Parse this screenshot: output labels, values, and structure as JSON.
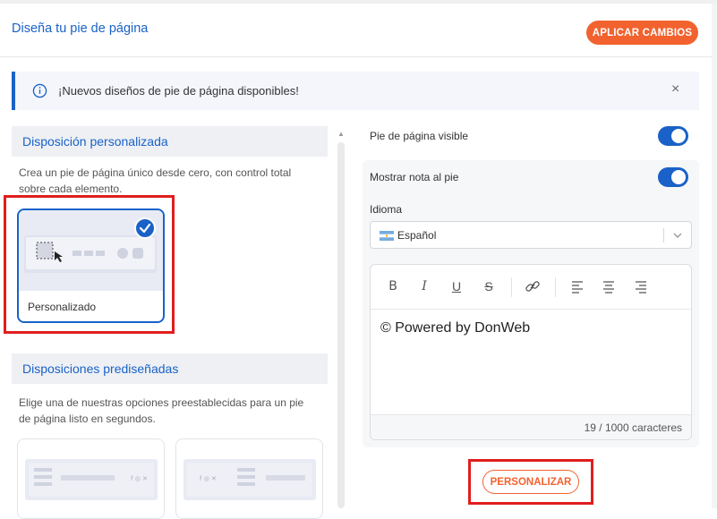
{
  "header": {
    "title": "Diseña tu pie de página",
    "apply_label": "APLICAR CAMBIOS"
  },
  "alert": {
    "message": "¡Nuevos diseños de pie de página disponibles!",
    "info_icon": "info-icon",
    "close_icon": "close-icon",
    "close_glyph": "×"
  },
  "custom_section": {
    "heading": "Disposición personalizada",
    "description": "Crea un pie de página único desde cero, con control total sobre cada elemento.",
    "card_label": "Personalizado"
  },
  "preset_section": {
    "heading": "Disposiciones prediseñadas",
    "description": "Elige una de nuestras opciones preestablecidas para un pie de página listo en segundos."
  },
  "settings": {
    "footer_visible_label": "Pie de página visible",
    "footer_visible": true,
    "show_note_label": "Mostrar nota al pie",
    "show_note": true,
    "language_label": "Idioma",
    "language_value": "Español"
  },
  "editor": {
    "toolbar": [
      {
        "name": "bold-button",
        "glyph": "B"
      },
      {
        "name": "italic-button",
        "glyph": "I"
      },
      {
        "name": "underline-button",
        "glyph": "U"
      },
      {
        "name": "strikethrough-button",
        "glyph": "S"
      },
      {
        "name": "link-button",
        "glyph": "link-icon"
      },
      {
        "name": "align-left-button",
        "glyph": "align-left-icon"
      },
      {
        "name": "align-center-button",
        "glyph": "align-center-icon"
      },
      {
        "name": "align-right-button",
        "glyph": "align-right-icon"
      }
    ],
    "content": "© Powered by DonWeb",
    "counter": "19 / 1000 caracteres"
  },
  "personalize_label": "PERSONALIZAR",
  "colors": {
    "accent": "#1a62c7",
    "brand_orange": "#f2622e",
    "highlight_red": "#e01e1e"
  }
}
